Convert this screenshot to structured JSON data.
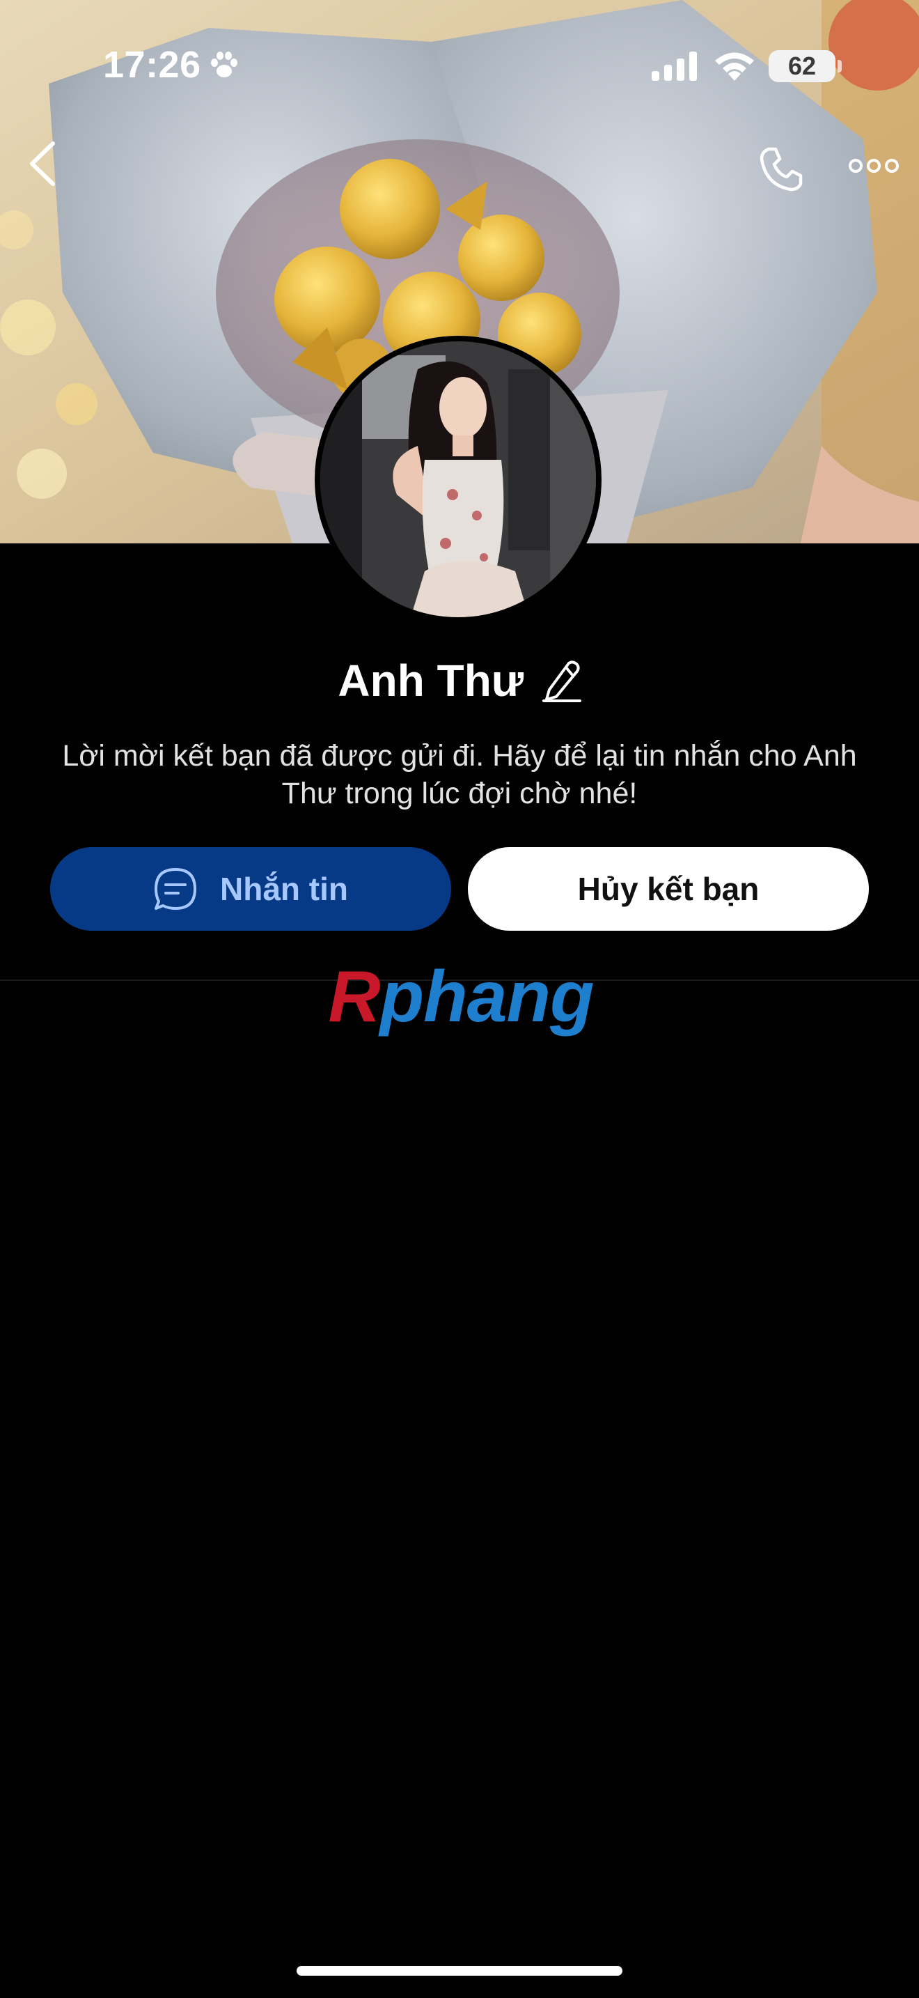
{
  "status_bar": {
    "time": "17:26",
    "battery": "62",
    "icons": [
      "paw-icon",
      "cellular-signal-icon",
      "wifi-icon",
      "battery-icon"
    ]
  },
  "header": {
    "icons": [
      "back-chevron-icon",
      "phone-icon",
      "more-horizontal-icon"
    ]
  },
  "profile": {
    "name": "Anh Thư",
    "name_icon": "pencil-edit-icon",
    "message": "Lời mời kết bạn đã được gửi đi. Hãy để lại tin nhắn cho Anh Thư trong lúc đợi chờ nhé!"
  },
  "actions": {
    "message_label": "Nhắn tin",
    "message_icon": "chat-bubble-icon",
    "unfriend_label": "Hủy kết bạn"
  },
  "watermark": {
    "first_letter": "R",
    "rest": "phang"
  },
  "colors": {
    "background": "#000000",
    "message_button": "#073a86",
    "message_button_text": "#a7c8ff",
    "unfriend_button": "#ffffff",
    "watermark_red": "#c8182a",
    "watermark_blue": "#1f7fcf"
  }
}
